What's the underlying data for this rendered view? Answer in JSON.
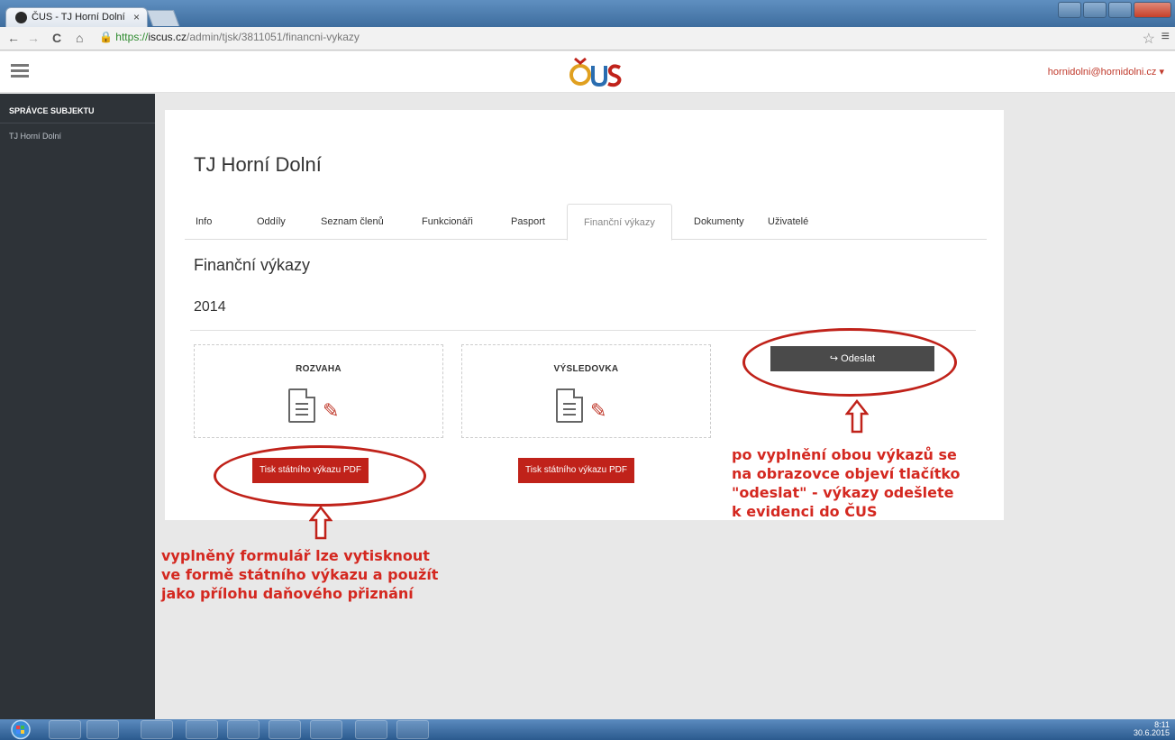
{
  "browser": {
    "tab_title": "ČUS - TJ Horní Dolní",
    "tab_close": "×",
    "url_scheme": "https://",
    "url_host": "iscus.cz",
    "url_path": "/admin/tjsk/3811051/financni-vykazy",
    "back": "←",
    "forward": "→",
    "reload": "C",
    "home": "⌂",
    "star": "☆",
    "menu": "≡"
  },
  "header": {
    "user_email": "hornidolni@hornidolni.cz ▾"
  },
  "sidebar": {
    "heading": "SPRÁVCE SUBJEKTU",
    "items": [
      {
        "label": "TJ Horní Dolní"
      }
    ]
  },
  "main": {
    "entity_title": "TJ Horní Dolní",
    "tabs": [
      {
        "label": "Info"
      },
      {
        "label": "Oddíly"
      },
      {
        "label": "Seznam členů"
      },
      {
        "label": "Funkcionáři"
      },
      {
        "label": "Pasport"
      },
      {
        "label": "Finanční výkazy",
        "active": true
      },
      {
        "label": "Dokumenty"
      },
      {
        "label": "Uživatelé"
      }
    ],
    "section_title": "Finanční výkazy",
    "year": "2014",
    "reports": [
      {
        "label": "ROZVAHA",
        "pdf_button": "Tisk státního výkazu PDF"
      },
      {
        "label": "VÝSLEDOVKA",
        "pdf_button": "Tisk státního výkazu PDF"
      }
    ],
    "send_button": "Odeslat",
    "send_icon": "↪"
  },
  "annotations": {
    "left": [
      "vyplněný formulář lze vytisknout",
      "ve formě státního výkazu a použít",
      "jako přílohu daňového přiznání"
    ],
    "right": [
      "po vyplnění obou výkazů se",
      "na obrazovce objeví tlačítko",
      "\"odeslat\" - výkazy odešlete",
      "k evidenci do ČUS"
    ]
  },
  "taskbar": {
    "time": "8:11",
    "date": "30.6.2015"
  },
  "colors": {
    "accent_red": "#c0221a",
    "sidebar_bg": "#2e3338",
    "annotation_red": "#d42820"
  }
}
